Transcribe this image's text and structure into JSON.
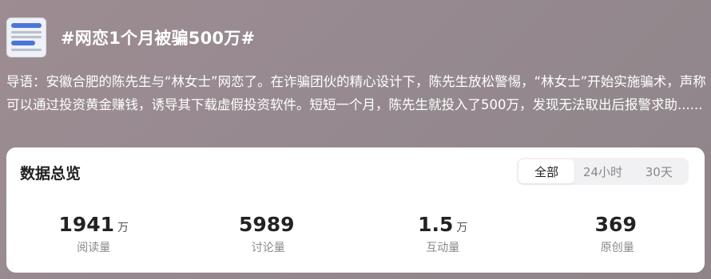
{
  "topic": {
    "title": "#网恋1个月被骗500万#",
    "intro": "导语：安徽合肥的陈先生与“林女士”网恋了。在诈骗团伙的精心设计下，陈先生放松警惕，“林女士”开始实施骗术，声称可以通过投资黄金赚钱，诱导其下载虚假投资软件。短短一个月，陈先生就投入了500万，发现无法取出后报警求助......"
  },
  "overview": {
    "title": "数据总览",
    "tabs": [
      {
        "label": "全部",
        "active": true
      },
      {
        "label": "24小时",
        "active": false
      },
      {
        "label": "30天",
        "active": false
      }
    ],
    "stats": [
      {
        "value": "1941",
        "unit": "万",
        "label": "阅读量"
      },
      {
        "value": "5989",
        "unit": "",
        "label": "讨论量"
      },
      {
        "value": "1.5",
        "unit": "万",
        "label": "互动量"
      },
      {
        "value": "369",
        "unit": "",
        "label": "原创量"
      }
    ]
  }
}
